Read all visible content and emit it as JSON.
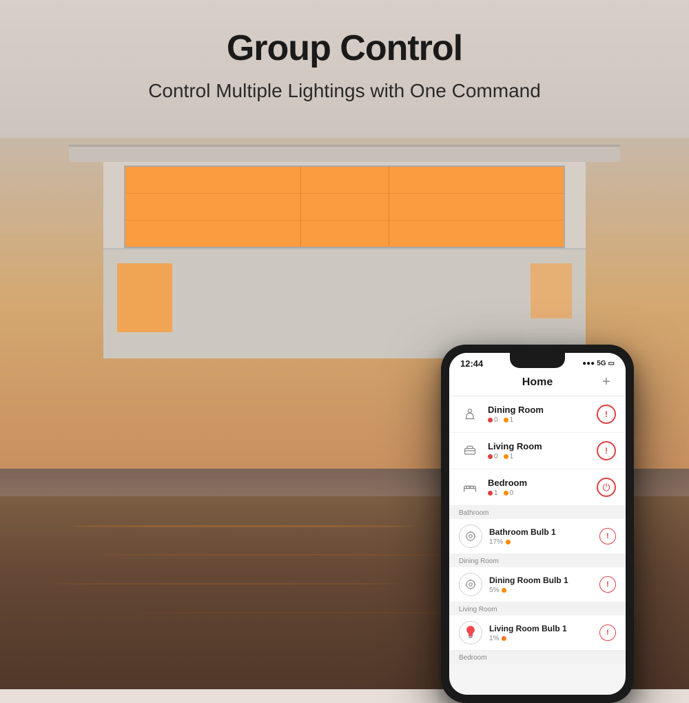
{
  "page": {
    "title": "Group Control",
    "subtitle": "Control Multiple Lightings with One Command"
  },
  "phone": {
    "status_bar": {
      "time": "12:44",
      "signal": "▋▋▋",
      "network": "5G",
      "battery": "🔋"
    },
    "app_header": {
      "title": "Home",
      "add_button": "+"
    },
    "rooms": [
      {
        "name": "Dining Room",
        "icon": "🍴",
        "offline": "0",
        "online": "1",
        "action": "!"
      },
      {
        "name": "Living Room",
        "icon": "🛋",
        "offline": "0",
        "online": "1",
        "action": "!"
      },
      {
        "name": "Bedroom",
        "icon": "🛏",
        "offline": "1",
        "online": "0",
        "action": "power"
      }
    ],
    "sections": [
      {
        "label": "Bathroom",
        "devices": [
          {
            "name": "Bathroom Bulb 1",
            "percentage": "17%",
            "status_color": "orange",
            "action": "!"
          }
        ]
      },
      {
        "label": "Dining Room",
        "devices": [
          {
            "name": "Dining Room Bulb 1",
            "percentage": "5%",
            "status_color": "orange",
            "action": "!"
          }
        ]
      },
      {
        "label": "Living Room",
        "devices": [
          {
            "name": "Living Room Bulb 1",
            "percentage": "1%",
            "status_color": "multicolor",
            "action": "!"
          }
        ]
      },
      {
        "label": "Bedroom",
        "devices": []
      }
    ]
  }
}
